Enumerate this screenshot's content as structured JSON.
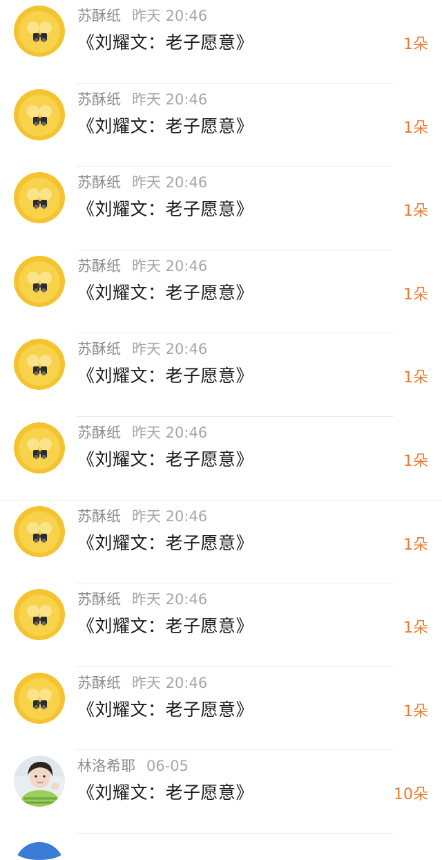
{
  "gifts": [
    {
      "user": "苏酥纸",
      "time": "昨天 20:46",
      "title": "《刘耀文：老子愿意》",
      "count": "1朵",
      "avatar": "yellow-duck-binoculars"
    },
    {
      "user": "苏酥纸",
      "time": "昨天 20:46",
      "title": "《刘耀文：老子愿意》",
      "count": "1朵",
      "avatar": "yellow-duck-binoculars"
    },
    {
      "user": "苏酥纸",
      "time": "昨天 20:46",
      "title": "《刘耀文：老子愿意》",
      "count": "1朵",
      "avatar": "yellow-duck-binoculars"
    },
    {
      "user": "苏酥纸",
      "time": "昨天 20:46",
      "title": "《刘耀文：老子愿意》",
      "count": "1朵",
      "avatar": "yellow-duck-binoculars"
    },
    {
      "user": "苏酥纸",
      "time": "昨天 20:46",
      "title": "《刘耀文：老子愿意》",
      "count": "1朵",
      "avatar": "yellow-duck-binoculars"
    },
    {
      "user": "苏酥纸",
      "time": "昨天 20:46",
      "title": "《刘耀文：老子愿意》",
      "count": "1朵",
      "avatar": "yellow-duck-binoculars"
    },
    {
      "user": "苏酥纸",
      "time": "昨天 20:46",
      "title": "《刘耀文：老子愿意》",
      "count": "1朵",
      "avatar": "yellow-duck-binoculars"
    },
    {
      "user": "苏酥纸",
      "time": "昨天 20:46",
      "title": "《刘耀文：老子愿意》",
      "count": "1朵",
      "avatar": "yellow-duck-binoculars"
    },
    {
      "user": "苏酥纸",
      "time": "昨天 20:46",
      "title": "《刘耀文：老子愿意》",
      "count": "1朵",
      "avatar": "yellow-duck-binoculars"
    },
    {
      "user": "林洛希耶",
      "time": "06-05",
      "title": "《刘耀文：老子愿意》",
      "count": "10朵",
      "avatar": "person-photo"
    }
  ],
  "colors": {
    "count_accent": "#ec7b31",
    "meta_text": "#8c8c8c",
    "title_text": "#1a1a1a"
  }
}
